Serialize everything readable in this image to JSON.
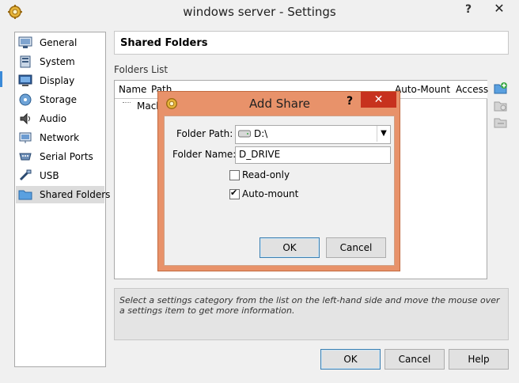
{
  "window": {
    "title": "windows server - Settings",
    "help_glyph": "?",
    "close_glyph": "✕"
  },
  "sidebar": {
    "items": [
      {
        "label": "General",
        "icon": "general-icon"
      },
      {
        "label": "System",
        "icon": "system-icon"
      },
      {
        "label": "Display",
        "icon": "display-icon"
      },
      {
        "label": "Storage",
        "icon": "storage-icon"
      },
      {
        "label": "Audio",
        "icon": "audio-icon"
      },
      {
        "label": "Network",
        "icon": "network-icon"
      },
      {
        "label": "Serial Ports",
        "icon": "serial-ports-icon"
      },
      {
        "label": "USB",
        "icon": "usb-icon"
      },
      {
        "label": "Shared Folders",
        "icon": "shared-folders-icon",
        "selected": true
      }
    ]
  },
  "main": {
    "header": "Shared Folders",
    "folders_label": "Folders List",
    "table": {
      "columns": [
        "Name",
        "Path",
        "Auto-Mount",
        "Access"
      ],
      "rows": [
        {
          "name": "Mach"
        }
      ]
    },
    "info": "Select a settings category from the list on the left-hand side and move the mouse over a settings item to get more information."
  },
  "buttons": {
    "ok": "OK",
    "cancel": "Cancel",
    "help": "Help"
  },
  "dialog": {
    "title": "Add Share",
    "help_glyph": "?",
    "close_glyph": "✕",
    "folder_path_label": "Folder Path:",
    "folder_path_value": "D:\\",
    "folder_name_label": "Folder Name:",
    "folder_name_value": "D_DRIVE",
    "readonly_label": "Read-only",
    "readonly_checked": false,
    "automount_label": "Auto-mount",
    "automount_checked": true,
    "ok": "OK",
    "cancel": "Cancel"
  },
  "colors": {
    "dialog_frame": "#e8926a",
    "dialog_close": "#c7321e",
    "selection": "#dcdcdc"
  }
}
